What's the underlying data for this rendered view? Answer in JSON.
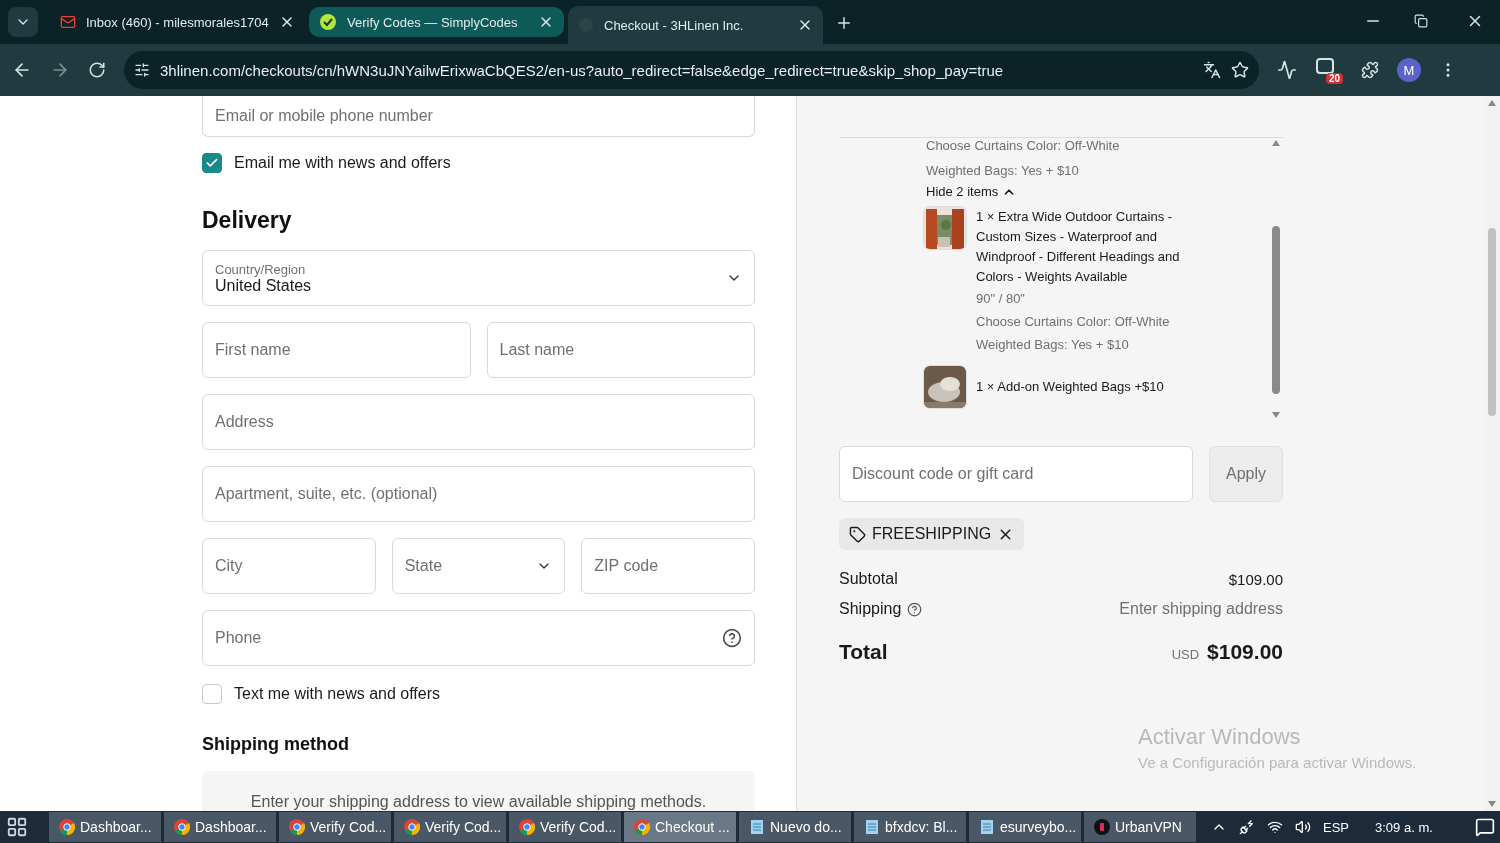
{
  "browser": {
    "tabs": [
      {
        "title": "Inbox (460) - milesmorales1704",
        "selected": false
      },
      {
        "title": "Verify Codes — SimplyCodes",
        "selected": false
      },
      {
        "title": "Checkout - 3HLinen Inc.",
        "selected": true
      }
    ],
    "url": "3hlinen.com/checkouts/cn/hWN3uJNYailwErixwaCbQES2/en-us?auto_redirect=false&edge_redirect=true&skip_shop_pay=true",
    "extension_badge": "20",
    "profile": "M"
  },
  "contact": {
    "email_placeholder": "Email or mobile phone number",
    "news": {
      "label": "Email me with news and offers",
      "checked": true
    }
  },
  "delivery": {
    "title": "Delivery",
    "rows": [
      [
        {
          "kind": "select",
          "label": "Country/Region",
          "value": "United States"
        }
      ],
      [
        {
          "kind": "text",
          "placeholder": "First name"
        },
        {
          "kind": "text",
          "placeholder": "Last name"
        }
      ],
      [
        {
          "kind": "text",
          "placeholder": "Address"
        }
      ],
      [
        {
          "kind": "text",
          "placeholder": "Apartment, suite, etc. (optional)"
        }
      ],
      [
        {
          "kind": "text",
          "placeholder": "City"
        },
        {
          "kind": "select",
          "placeholder": "State"
        },
        {
          "kind": "text",
          "placeholder": "ZIP code"
        }
      ],
      [
        {
          "kind": "phone",
          "placeholder": "Phone"
        }
      ]
    ],
    "text_me": {
      "label": "Text me with news and offers",
      "checked": false
    }
  },
  "shipping_method": {
    "title": "Shipping method",
    "message": "Enter your shipping address to view available shipping methods."
  },
  "summary": {
    "prior_options": [
      "Choose Curtains Color: Off-White",
      "Weighted Bags: Yes + $10"
    ],
    "toggle": "Hide 2 items",
    "items": [
      {
        "title": "1 × Extra Wide Outdoor Curtains - Custom Sizes - Waterproof and Windproof - Different Headings and Colors - Weights Available",
        "variant": "90\" / 80\"",
        "options": [
          "Choose Curtains Color: Off-White",
          "Weighted Bags: Yes + $10"
        ]
      },
      {
        "title": "1 × Add-on Weighted Bags +$10"
      }
    ],
    "discount": {
      "placeholder": "Discount code or gift card",
      "button": "Apply"
    },
    "code": "FREESHIPPING",
    "subtotal": {
      "label": "Subtotal",
      "value": "$109.00"
    },
    "shipping": {
      "label": "Shipping",
      "value": "Enter shipping address"
    },
    "total": {
      "label": "Total",
      "currency": "USD",
      "value": "$109.00"
    }
  },
  "os_notice": {
    "title": "Activar Windows",
    "text": "Ve a Configuración para activar Windows."
  },
  "taskbar": {
    "apps": [
      {
        "label": "Dashboar...",
        "kind": "browser",
        "selected": false
      },
      {
        "label": "Dashboar...",
        "kind": "browser",
        "selected": false
      },
      {
        "label": "Verify Cod...",
        "kind": "browser",
        "selected": false
      },
      {
        "label": "Verify Cod...",
        "kind": "browser",
        "selected": false
      },
      {
        "label": "Verify Cod...",
        "kind": "browser",
        "selected": false
      },
      {
        "label": "Checkout ...",
        "kind": "browser",
        "selected": true
      },
      {
        "label": "Nuevo do...",
        "kind": "notepad",
        "selected": false
      },
      {
        "label": "bfxdcv: Bl...",
        "kind": "notepad",
        "selected": false
      },
      {
        "label": "esurveybo...",
        "kind": "notepad",
        "selected": false
      },
      {
        "label": "UrbanVPN",
        "kind": "vpn",
        "selected": false
      }
    ],
    "language": "ESP",
    "time": "3:09 a. m."
  }
}
